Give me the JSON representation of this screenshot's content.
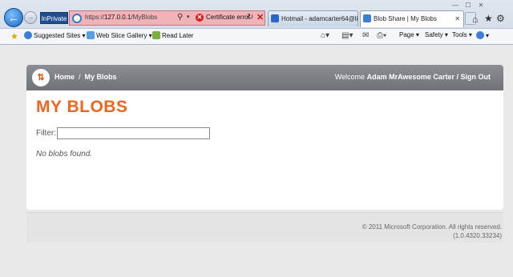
{
  "browser": {
    "inprivate_label": "InPrivate",
    "address": {
      "url_prefix": "https://",
      "url_host": "127.0.0.1",
      "url_path": "/MyBlobs",
      "certificate_error": "Certificate error"
    },
    "tabs": [
      {
        "title": "Hotmail - adamcarter64@liv..."
      },
      {
        "title": "Blob Share | My Blobs",
        "active": true
      }
    ],
    "command_bar": {
      "suggested_sites": "Suggested Sites ▾",
      "web_slice_gallery": "Web Slice Gallery ▾",
      "read_later": "Read Later",
      "page_menu": "Page ▾",
      "safety_menu": "Safety ▾",
      "tools_menu": "Tools ▾",
      "help_menu": "▾"
    }
  },
  "site": {
    "breadcrumb": {
      "home": "Home",
      "separator": "/",
      "current": "My Blobs"
    },
    "user": {
      "welcome": "Welcome",
      "name": "Adam MrAwesome Carter",
      "separator": "/",
      "sign_out": "Sign Out"
    },
    "main": {
      "title": "MY BLOBS",
      "filter_label": "Filter:",
      "filter_value": "",
      "empty_message": "No blobs found."
    },
    "footer": {
      "copyright": "© 2011 Microsoft Corporation. All rights reserved.",
      "version": "(1.0.4320.33234)"
    }
  },
  "colors": {
    "accent": "#f0641c",
    "header_bg": "#7c8085"
  }
}
